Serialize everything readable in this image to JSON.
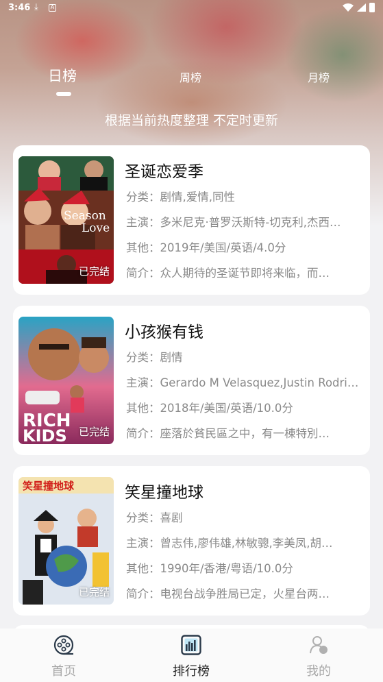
{
  "status_bar": {
    "time": "3:46",
    "icons": [
      "download-icon",
      "a-notification-icon",
      "wifi-icon",
      "cell-signal-icon",
      "battery-icon"
    ]
  },
  "tabs": [
    {
      "label": "日榜",
      "active": true
    },
    {
      "label": "周榜",
      "active": false
    },
    {
      "label": "月榜",
      "active": false
    }
  ],
  "subtitle": "根据当前热度整理 不定时更新",
  "movies": [
    {
      "title": "圣诞恋爱季",
      "genre_label": "分类：",
      "genre": "剧情,爱情,同性",
      "cast_label": "主演：",
      "cast": "多米尼克·普罗沃斯特-切克利,杰西…",
      "other_label": "其他：",
      "other": "2019年/美国/英语/4.0分",
      "intro_label": "简介：",
      "intro": "众人期待的圣诞节即将来临，而…",
      "status": "已完结",
      "poster_text": "Season Love"
    },
    {
      "title": "小孩猴有钱",
      "genre_label": "分类：",
      "genre": "剧情",
      "cast_label": "主演：",
      "cast": "Gerardo M Velasquez,Justin Rodri…",
      "other_label": "其他：",
      "other": "2018年/美国/英语/10.0分",
      "intro_label": "简介：",
      "intro": "座落於貧民區之中，有一棟特別…",
      "status": "已完结",
      "poster_text": "RICH KIDS"
    },
    {
      "title": "笑星撞地球",
      "genre_label": "分类：",
      "genre": "喜剧",
      "cast_label": "主演：",
      "cast": "曾志伟,廖伟雄,林敏骢,李美凤,胡…",
      "other_label": "其他：",
      "other": "1990年/香港/粤语/10.0分",
      "intro_label": "简介：",
      "intro": "电视台战争胜局已定，火星台两…",
      "status": "已完结",
      "poster_text": "笑星撞地球"
    }
  ],
  "nav": [
    {
      "label": "首页",
      "icon": "film-reel-icon",
      "active": false
    },
    {
      "label": "排行榜",
      "icon": "chart-bars-icon",
      "active": true
    },
    {
      "label": "我的",
      "icon": "profile-icon",
      "active": false
    }
  ],
  "colors": {
    "accent_nav_icon": "#2b3a4a",
    "text_secondary": "#8a8a8a",
    "background": "#f2f2f4"
  }
}
